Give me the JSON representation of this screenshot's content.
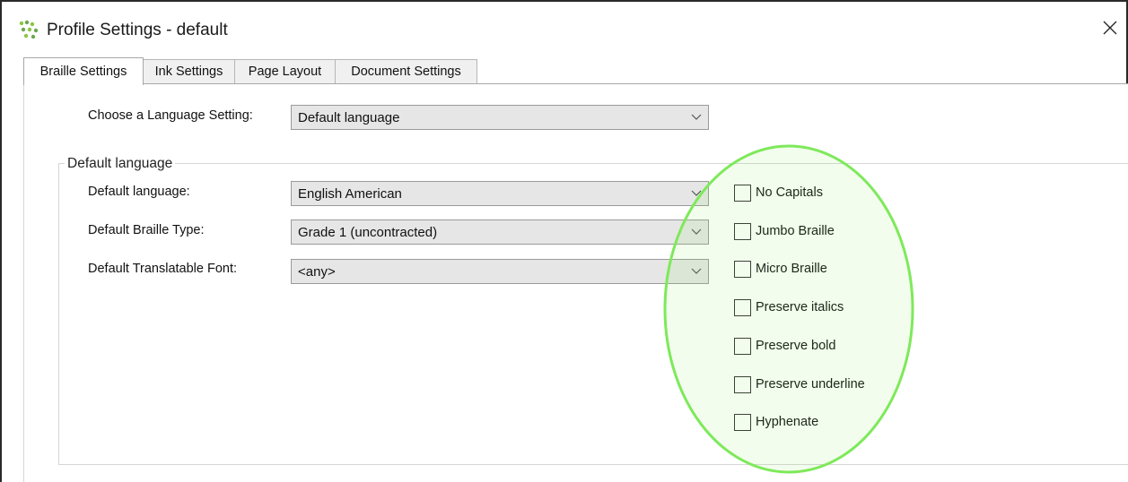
{
  "window": {
    "title": "Profile Settings - default"
  },
  "icons": {
    "app": "app-logo-icon",
    "close": "close-icon",
    "dropdown": "chevron-down-icon"
  },
  "tabs": [
    {
      "label": "Braille Settings",
      "active": true
    },
    {
      "label": "Ink Settings",
      "active": false
    },
    {
      "label": "Page Layout",
      "active": false
    },
    {
      "label": "Document Settings",
      "active": false
    }
  ],
  "language_setting": {
    "label": "Choose a Language Setting:",
    "value": "Default language"
  },
  "group": {
    "caption": "Default language",
    "fields": [
      {
        "label": "Default language:",
        "value": "English American"
      },
      {
        "label": "Default Braille Type:",
        "value": "Grade 1 (uncontracted)"
      },
      {
        "label": "Default Translatable Font:",
        "value": "<any>"
      }
    ],
    "checkboxes": [
      {
        "label": "No Capitals",
        "checked": false
      },
      {
        "label": "Jumbo Braille",
        "checked": false
      },
      {
        "label": "Micro Braille",
        "checked": false
      },
      {
        "label": "Preserve italics",
        "checked": false
      },
      {
        "label": "Preserve bold",
        "checked": false
      },
      {
        "label": "Preserve underline",
        "checked": false
      },
      {
        "label": "Hyphenate",
        "checked": false
      }
    ]
  },
  "colors": {
    "highlight": "#7ee95a",
    "combo_bg": "#e6e6e6",
    "icon_green": "#7dbb3b"
  }
}
